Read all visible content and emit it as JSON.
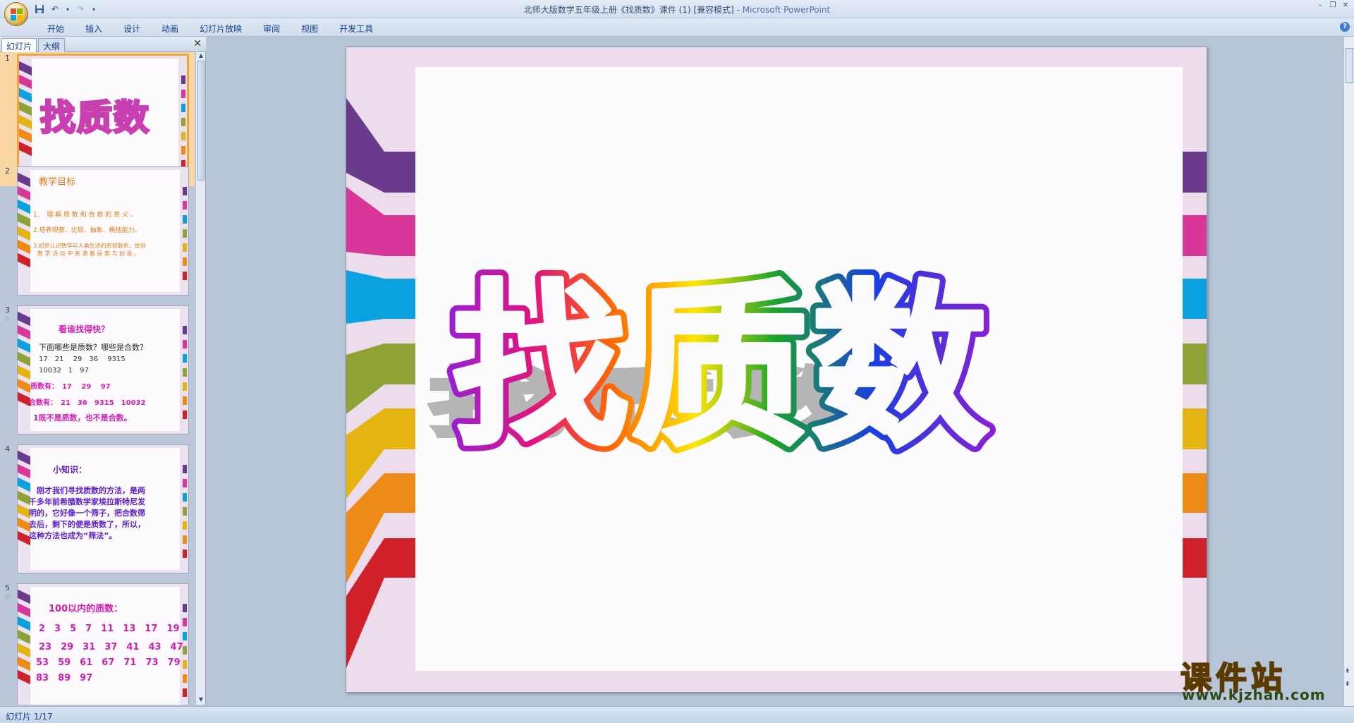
{
  "window": {
    "title": "北师大版数学五年级上册《找质数》课件 (1) [兼容模式]",
    "app_name": "Microsoft PowerPoint",
    "controls": [
      "–",
      "❐",
      "✕"
    ]
  },
  "ribbon": {
    "tabs": [
      "开始",
      "插入",
      "设计",
      "动画",
      "幻灯片放映",
      "审阅",
      "视图",
      "开发工具"
    ],
    "help": "?"
  },
  "left_pane": {
    "tab_slides": "幻灯片",
    "tab_outline": "大纲",
    "close": "✕"
  },
  "slides": [
    {
      "number": "1",
      "title": "找质数"
    },
    {
      "number": "2",
      "heading": "教学目标",
      "lines": [
        "1．　理 解 质 数 和 合 数 的 意 义 。",
        "2.培养观察、比较、抽象、概括能力。",
        "3.初步认识数学与人类生活的密切联系，体验",
        "数 学 活 动 中 充 满 着 探 索 与 创 造 。"
      ]
    },
    {
      "number": "3",
      "heading": "看谁找得快？",
      "lines": [
        "下面哪些是质数？哪些是合数？",
        "17　21　 29　36　 9315",
        "10032　1　97",
        "质数有：　17　 29　 97",
        "合数有：　21　36　9315　10032",
        "1既不是质数，也不是合数。"
      ]
    },
    {
      "number": "4",
      "heading": "小知识：",
      "lines": [
        "　刚才我们寻找质数的方法，是两",
        "千多年前希腊数学家埃拉斯特尼发",
        "明的，它好像一个筛子，把合数筛",
        "去后，剩下的便是质数了，所以，",
        "这种方法也成为“筛法”。"
      ]
    },
    {
      "number": "5",
      "heading": "100以内的质数：",
      "lines": [
        "2　3　5　7　11　13　17　19",
        "23　29　31　37　41　43　47",
        "53　59　61　67　71　73　79",
        "83　89　97"
      ]
    }
  ],
  "main_slide": {
    "title": "找质数"
  },
  "status": {
    "text": "幻灯片 1/17"
  },
  "watermark": {
    "text": "课件站",
    "url": "www.kjzhan.com"
  },
  "colors": {
    "stripes": [
      "#6a3a8c",
      "#d9369a",
      "#0aa1e0",
      "#8fa236",
      "#e6b412",
      "#ee8a16",
      "#d0212a"
    ],
    "selection": "#f5a443"
  }
}
